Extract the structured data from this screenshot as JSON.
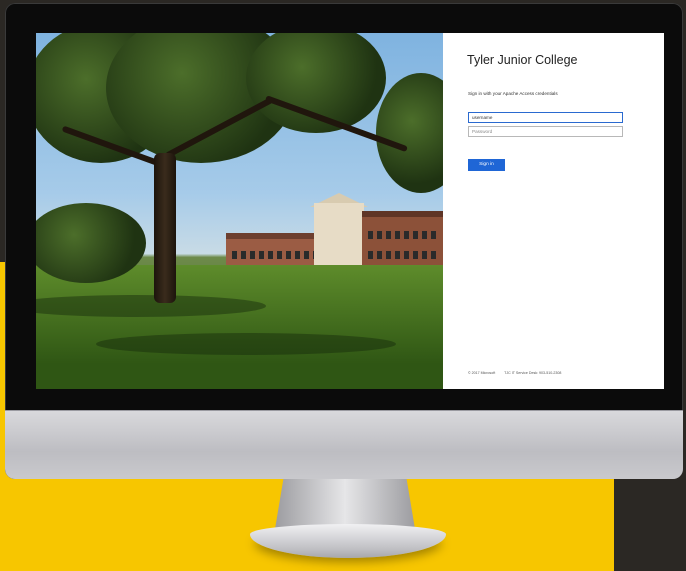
{
  "login": {
    "title": "Tyler Junior College",
    "instructions": "Sign in with your Apache Access credentials",
    "username_value": "username",
    "password_placeholder": "Password",
    "signin_label": "Sign in",
    "footer_copyright": "© 2017 Microsoft",
    "footer_service": "TJC IT Service Desk: 903-510-2308"
  },
  "colors": {
    "accent": "#1f66d6",
    "background_yellow": "#f7c600",
    "background_dark": "#2b2824"
  }
}
